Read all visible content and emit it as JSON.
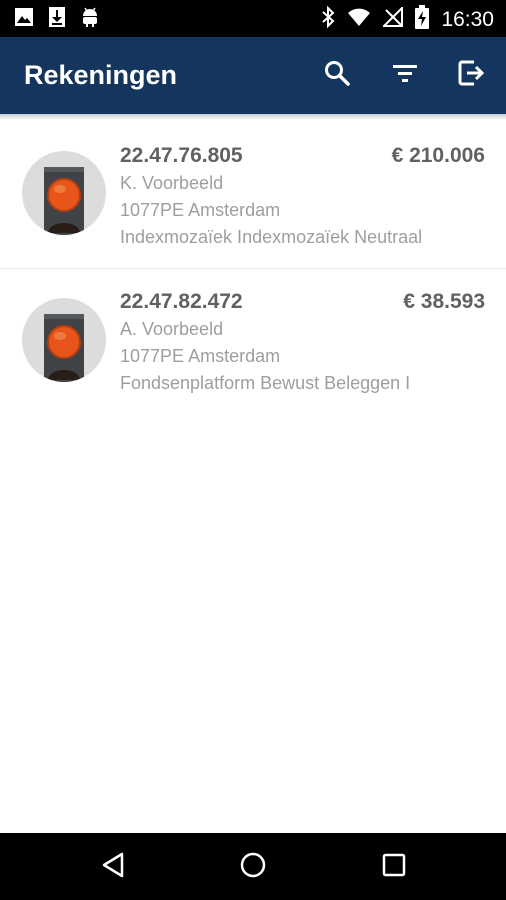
{
  "status_bar": {
    "time": "16:30",
    "left_icons": [
      "image-icon",
      "download-icon",
      "android-icon"
    ],
    "right_icons": [
      "bluetooth-icon",
      "wifi-icon",
      "no-signal-icon",
      "battery-charging-icon"
    ]
  },
  "app_bar": {
    "title": "Rekeningen",
    "actions": [
      "search-icon",
      "filter-icon",
      "logout-icon"
    ],
    "background": "#14365e"
  },
  "accounts": [
    {
      "number": "22.47.76.805",
      "amount": "€ 210.006",
      "name": "K. Voorbeeld",
      "address": "1077PE  Amsterdam",
      "product": "Indexmozaïek Indexmozaïek Neutraal",
      "status_icon": "traffic-light-red-icon"
    },
    {
      "number": "22.47.82.472",
      "amount": "€ 38.593",
      "name": "A. Voorbeeld",
      "address": "1077PE  Amsterdam",
      "product": "Fondsenplatform Bewust Beleggen I",
      "status_icon": "traffic-light-red-icon"
    }
  ],
  "nav_bar": {
    "buttons": [
      "back-icon",
      "home-icon",
      "recents-icon"
    ]
  }
}
